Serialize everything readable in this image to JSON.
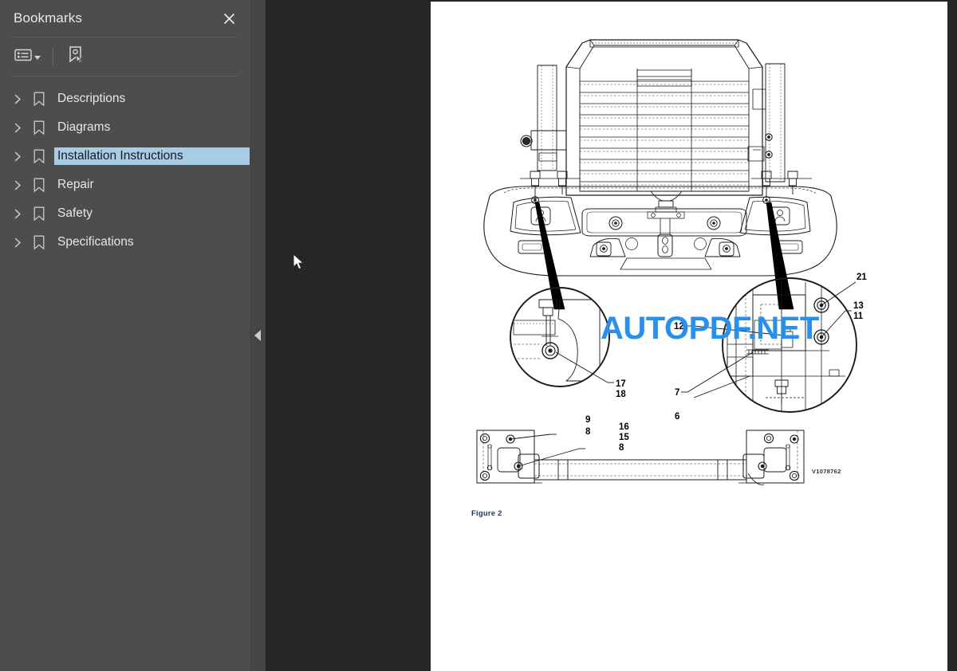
{
  "sidebar": {
    "title": "Bookmarks",
    "close_icon": "close-icon",
    "toolbar": {
      "options_icon": "list-options-icon",
      "options_caret_icon": "chevron-down-icon",
      "new_bookmark_icon": "new-bookmark-icon"
    },
    "items": [
      {
        "label": "Descriptions",
        "expand_icon": "chevron-right-icon",
        "bookmark_icon": "bookmark-icon",
        "selected": false
      },
      {
        "label": "Diagrams",
        "expand_icon": "chevron-right-icon",
        "bookmark_icon": "bookmark-icon",
        "selected": false
      },
      {
        "label": "Installation Instructions",
        "expand_icon": "chevron-right-icon",
        "bookmark_icon": "bookmark-icon",
        "selected": true
      },
      {
        "label": "Repair",
        "expand_icon": "chevron-right-icon",
        "bookmark_icon": "bookmark-icon",
        "selected": false
      },
      {
        "label": "Safety",
        "expand_icon": "chevron-right-icon",
        "bookmark_icon": "bookmark-icon",
        "selected": false
      },
      {
        "label": "Specifications",
        "expand_icon": "chevron-right-icon",
        "bookmark_icon": "bookmark-icon",
        "selected": false
      }
    ]
  },
  "splitter": {
    "collapse_icon": "collapse-left-arrow-icon"
  },
  "viewer": {
    "watermark": "AUTOPDF.NET",
    "cursor_icon": "arrow-cursor",
    "page": {
      "figure_caption": "Figure 2",
      "drawing_number": "V1078762",
      "callouts": [
        {
          "id": "c21",
          "text": "21"
        },
        {
          "id": "c13",
          "text": "13"
        },
        {
          "id": "c11",
          "text": "11"
        },
        {
          "id": "c12",
          "text": "12"
        },
        {
          "id": "c7",
          "text": "7"
        },
        {
          "id": "c6",
          "text": "6"
        },
        {
          "id": "c17",
          "text": "17"
        },
        {
          "id": "c18",
          "text": "18"
        },
        {
          "id": "c9",
          "text": "9"
        },
        {
          "id": "c8a",
          "text": "8"
        },
        {
          "id": "c16",
          "text": "16"
        },
        {
          "id": "c15",
          "text": "15"
        },
        {
          "id": "c8b",
          "text": "8"
        }
      ]
    }
  },
  "colors": {
    "sidebar_bg": "#4d4d4d",
    "viewer_bg": "#262626",
    "selection": "#a8cce3",
    "watermark": "#2491f2",
    "caption": "#1f3864"
  }
}
